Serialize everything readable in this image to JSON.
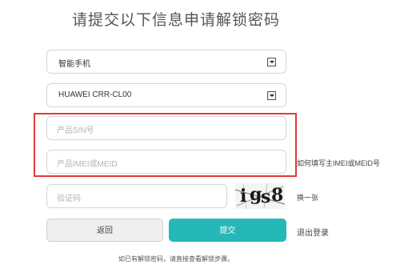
{
  "title": "请提交以下信息申请解锁密码",
  "device_type": {
    "selected": "智能手机"
  },
  "device_model": {
    "selected": "HUAWEI CRR-CL00"
  },
  "serial_input": {
    "placeholder": "产品S/N号"
  },
  "imei_input": {
    "placeholder": "产品IMEI或MEID"
  },
  "imei_help_link": "如何填写主IMEI或MEID号",
  "captcha_input": {
    "placeholder": "验证码"
  },
  "captcha_chars": [
    "i",
    "g",
    "s",
    "8"
  ],
  "captcha_refresh": "换一张",
  "buttons": {
    "back": "返回",
    "submit": "提交"
  },
  "logout_link": "退出登录",
  "hint": "如已有解锁密码，请直接查看解锁步骤。",
  "colors": {
    "submit": "#26b8b7",
    "highlight": "#e13a3a"
  }
}
